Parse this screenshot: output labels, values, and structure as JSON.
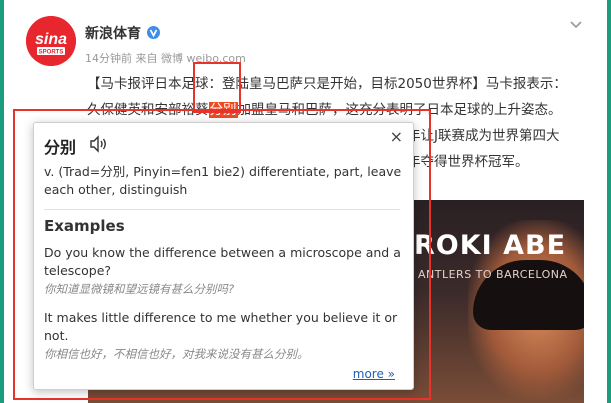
{
  "post": {
    "author": "新浪体育",
    "avatar_text": "sina",
    "avatar_subtext": "SPORTS",
    "meta": "14分钟前 来自 微博 weibo.com",
    "lines": [
      "【马卡报评日本足球：登陆皇马巴萨只是开始，目标2050世界杯】马卡报表示：",
      "久保健英和安部裕葵",
      "加盟皇马和巴萨，这充分表明了日本足球的上升姿态。",
      "年让J联赛成为世界第四大",
      "年夺得世界杯冠军。"
    ],
    "highlight": "分别"
  },
  "media": {
    "title": "ROKI ABE",
    "subtitle": "ANTLERS TO BARCELONA"
  },
  "popup": {
    "word": "分别",
    "speaker_icon": "speaker-icon",
    "close": "×",
    "definition": "v. (Trad=分別, Pinyin=fen1 bie2) differentiate, part, leave each other, distinguish",
    "examples_title": "Examples",
    "examples": [
      {
        "en": "Do you know the difference between a microscope and a telescope?",
        "zh": "你知道显微镜和望远镜有甚么分别吗?"
      },
      {
        "en": "It makes little difference to me whether you believe it or not.",
        "zh": "你相信也好，不相信也好，对我来说没有甚么分别。"
      }
    ],
    "more": "more »"
  },
  "colors": {
    "accent": "#e8332b",
    "frame": "#1a9d7f",
    "link": "#1f5fb7"
  }
}
